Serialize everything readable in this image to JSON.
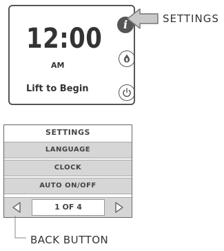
{
  "device": {
    "time": "12:00",
    "ampm": "AM",
    "prompt": "Lift to Begin",
    "info_icon": "i"
  },
  "callouts": {
    "settings": "SETTINGS",
    "back_button": "BACK BUTTON"
  },
  "menu": {
    "title": "SETTINGS",
    "items": [
      "LANGUAGE",
      "CLOCK",
      "AUTO ON/OFF"
    ],
    "page_indicator": "1 OF 4"
  },
  "icons": {
    "info": "info-icon",
    "drop": "drop-icon",
    "power": "power-icon",
    "prev": "triangle-left-icon",
    "next": "triangle-right-icon"
  },
  "colors": {
    "dark": "#555555",
    "menu_bg": "#d6d6d6"
  }
}
